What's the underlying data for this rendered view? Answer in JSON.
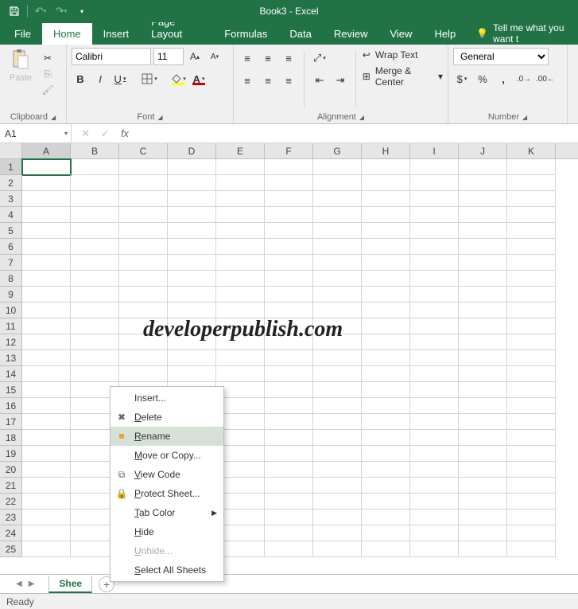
{
  "title": "Book3  -  Excel",
  "tabs": {
    "file": "File",
    "home": "Home",
    "insert": "Insert",
    "pagelayout": "Page Layout",
    "formulas": "Formulas",
    "data": "Data",
    "review": "Review",
    "view": "Help",
    "help": "View"
  },
  "tellme": "Tell me what you want t",
  "clipboard": {
    "paste": "Paste",
    "label": "Clipboard"
  },
  "font": {
    "name": "Calibri",
    "size": "11",
    "label": "Font",
    "bold": "B",
    "italic": "I",
    "underline": "U"
  },
  "alignment": {
    "label": "Alignment",
    "wrap": "Wrap Text",
    "merge": "Merge & Center"
  },
  "number": {
    "format": "General",
    "label": "Number"
  },
  "namebox": "A1",
  "columns": [
    "A",
    "B",
    "C",
    "D",
    "E",
    "F",
    "G",
    "H",
    "I",
    "J",
    "K"
  ],
  "rows": [
    "1",
    "2",
    "3",
    "4",
    "5",
    "6",
    "7",
    "8",
    "9",
    "10",
    "11",
    "12",
    "13",
    "14",
    "15",
    "16",
    "17",
    "18",
    "19",
    "20",
    "21",
    "22",
    "23",
    "24",
    "25"
  ],
  "watermark": "developerpublish.com",
  "sheet": {
    "name": "Shee"
  },
  "status": "Ready",
  "contextmenu": {
    "insert": "Insert...",
    "delete": "Delete",
    "rename": "Rename",
    "move": "Move or Copy...",
    "viewcode": "View Code",
    "protect": "Protect Sheet...",
    "tabcolor": "Tab Color",
    "hide": "Hide",
    "unhide": "Unhide...",
    "selectall": "Select All Sheets"
  }
}
